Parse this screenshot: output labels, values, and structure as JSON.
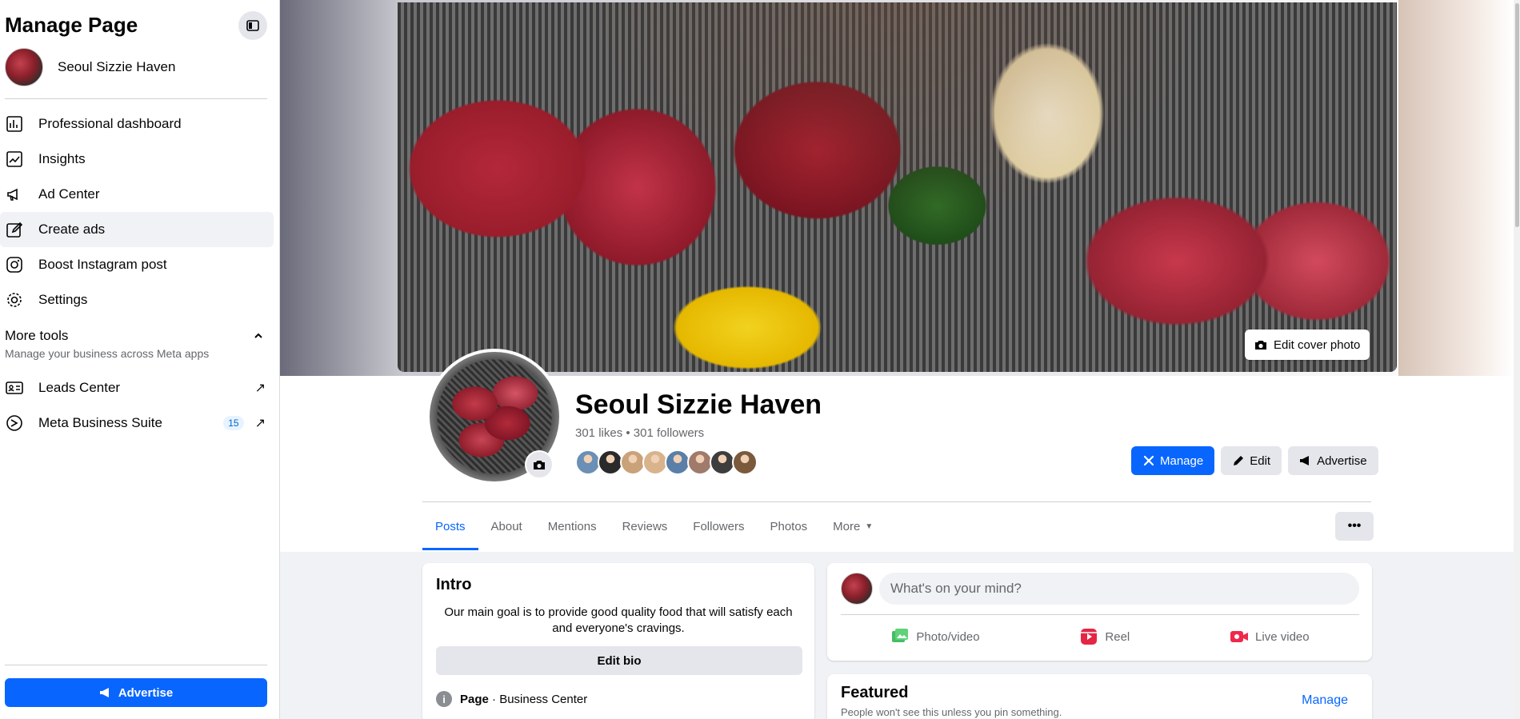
{
  "sidebar": {
    "title": "Manage Page",
    "page_name": "Seoul Sizzie Haven",
    "nav": [
      {
        "label": "Professional dashboard",
        "icon": "chart-icon"
      },
      {
        "label": "Insights",
        "icon": "insights-icon"
      },
      {
        "label": "Ad Center",
        "icon": "megaphone-icon"
      },
      {
        "label": "Create ads",
        "icon": "pencil-icon"
      },
      {
        "label": "Boost Instagram post",
        "icon": "instagram-icon"
      },
      {
        "label": "Settings",
        "icon": "gear-icon"
      }
    ],
    "more_tools": {
      "title": "More tools",
      "subtitle": "Manage your business across Meta apps"
    },
    "tools": [
      {
        "label": "Leads Center",
        "icon": "id-card-icon"
      },
      {
        "label": "Meta Business Suite",
        "icon": "meta-suite-icon",
        "badge": "15"
      }
    ],
    "advertise_label": "Advertise"
  },
  "header": {
    "edit_cover_label": "Edit cover photo",
    "page_name": "Seoul Sizzie Haven",
    "stats": "301 likes • 301 followers",
    "follower_faces": [
      "#6b8fb5",
      "#2a2a2a",
      "#c9a27a",
      "#d9b38c",
      "#5a7fa8",
      "#a07a6a",
      "#3d3d3d",
      "#7a5a3a"
    ],
    "actions": {
      "manage": "Manage",
      "edit": "Edit",
      "advertise": "Advertise"
    },
    "tabs": [
      "Posts",
      "About",
      "Mentions",
      "Reviews",
      "Followers",
      "Photos",
      "More"
    ],
    "more_tab": "More"
  },
  "intro": {
    "title": "Intro",
    "text": "Our main goal is to provide good quality food that will satisfy each and everyone's cravings.",
    "edit_bio": "Edit bio",
    "page_label": "Page",
    "category": " · Business Center"
  },
  "composer": {
    "placeholder": "What's on your mind?",
    "photo": "Photo/video",
    "reel": "Reel",
    "live": "Live video"
  },
  "featured": {
    "title": "Featured",
    "subtitle": "People won't see this unless you pin something.",
    "manage": "Manage"
  },
  "colors": {
    "accent": "#0866ff",
    "photo_green": "#45bd62",
    "reel_pink": "#e42645",
    "live_red": "#f02849"
  }
}
